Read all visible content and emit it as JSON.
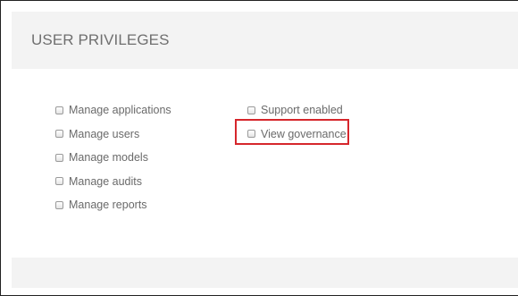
{
  "header": {
    "title": "USER PRIVILEGES"
  },
  "privileges": {
    "left": [
      {
        "label": "Manage applications",
        "checked": false
      },
      {
        "label": "Manage users",
        "checked": false
      },
      {
        "label": "Manage models",
        "checked": false
      },
      {
        "label": "Manage audits",
        "checked": false
      },
      {
        "label": "Manage reports",
        "checked": false
      }
    ],
    "right": [
      {
        "label": "Support enabled",
        "checked": false
      },
      {
        "label": "View governance",
        "checked": false
      }
    ]
  },
  "highlight": {
    "color": "#d6262c",
    "target": "View governance"
  }
}
